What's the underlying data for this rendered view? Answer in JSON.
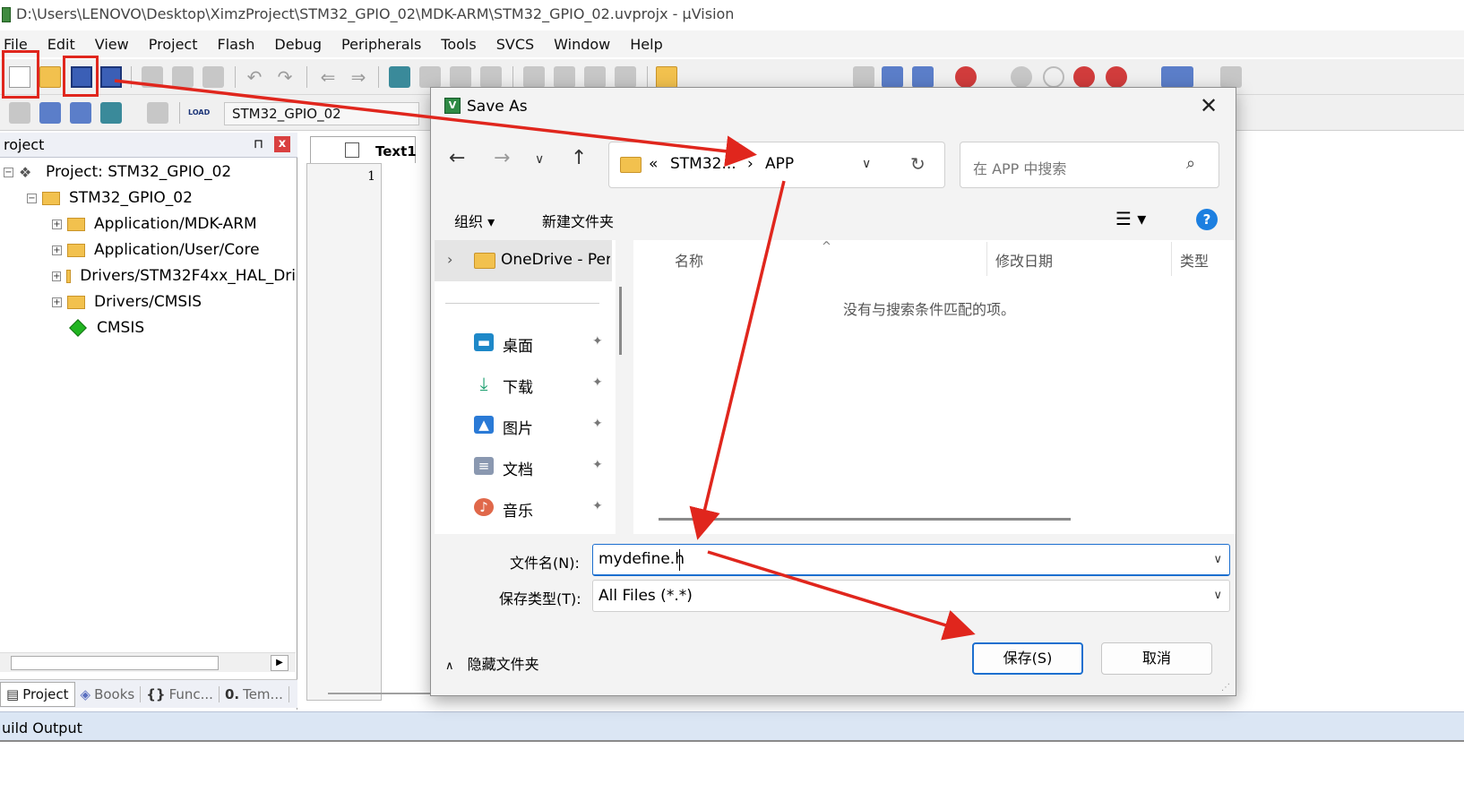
{
  "window": {
    "title": "D:\\Users\\LENOVO\\Desktop\\XimzProject\\STM32_GPIO_02\\MDK-ARM\\STM32_GPIO_02.uvprojx - µVision"
  },
  "menu": [
    "File",
    "Edit",
    "View",
    "Project",
    "Flash",
    "Debug",
    "Peripherals",
    "Tools",
    "SVCS",
    "Window",
    "Help"
  ],
  "toolbar": {
    "target": "STM32_GPIO_02",
    "load_label": "LOAD"
  },
  "project_pane": {
    "header": "roject",
    "pin": "⊓",
    "close": "x",
    "tree": [
      {
        "label": "Project: STM32_GPIO_02",
        "icon": "project-icon"
      },
      {
        "label": "STM32_GPIO_02",
        "icon": "target-folder-icon"
      },
      {
        "label": "Application/MDK-ARM",
        "icon": "folder-icon"
      },
      {
        "label": "Application/User/Core",
        "icon": "folder-icon"
      },
      {
        "label": "Drivers/STM32F4xx_HAL_Dri",
        "icon": "folder-icon"
      },
      {
        "label": "Drivers/CMSIS",
        "icon": "folder-icon"
      },
      {
        "label": "CMSIS",
        "icon": "cmsis-diamond-icon"
      }
    ],
    "tabs": [
      "Project",
      "Books",
      "Func...",
      "Tem..."
    ]
  },
  "editor": {
    "tab": "Text1",
    "line_number": "1"
  },
  "build_output": "uild Output",
  "dialog": {
    "title": "Save As",
    "address": {
      "prefix": "«",
      "parent": "STM32...",
      "separator": "›",
      "current": "APP"
    },
    "search_placeholder": "在 APP 中搜索",
    "organize": "组织 ▾",
    "new_folder": "新建文件夹",
    "nav": {
      "onedrive": "OneDrive - Per",
      "items": [
        {
          "label": "桌面",
          "icon": "desktop-icon",
          "color": "#1e88c8"
        },
        {
          "label": "下载",
          "icon": "download-icon",
          "color": "#1a9e6e"
        },
        {
          "label": "图片",
          "icon": "pictures-icon",
          "color": "#2a7ad6"
        },
        {
          "label": "文档",
          "icon": "documents-icon",
          "color": "#8a98b0"
        },
        {
          "label": "音乐",
          "icon": "music-icon",
          "color": "#e0684a"
        }
      ]
    },
    "columns": [
      "名称",
      "修改日期",
      "类型"
    ],
    "empty_message": "没有与搜索条件匹配的项。",
    "filename_label": "文件名(N):",
    "filename_value": "mydefine.h",
    "filetype_label": "保存类型(T):",
    "filetype_value": "All Files (*.*)",
    "hide_folders": "隐藏文件夹",
    "save_button": "保存(S)",
    "cancel_button": "取消"
  },
  "annotations": {
    "color": "#e0261d"
  }
}
